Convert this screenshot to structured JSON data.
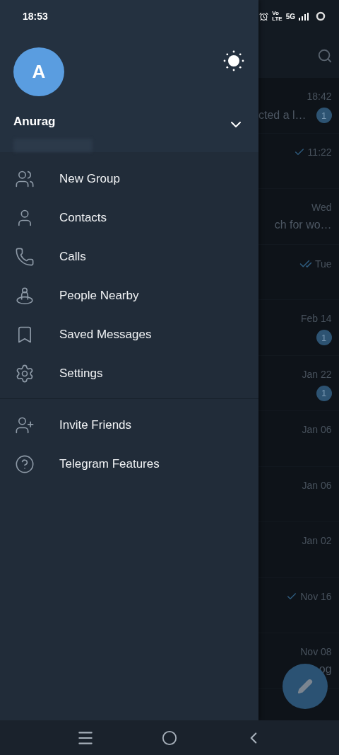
{
  "status_bar": {
    "time": "18:53",
    "volte_top": "Vo",
    "volte_bottom": "LTE",
    "network": "5G"
  },
  "drawer": {
    "avatar_initial": "A",
    "name": "Anurag",
    "accounts_expanded": false,
    "menu_sections": [
      [
        {
          "label": "New Group"
        },
        {
          "label": "Contacts"
        },
        {
          "label": "Calls"
        },
        {
          "label": "People Nearby"
        },
        {
          "label": "Saved Messages"
        },
        {
          "label": "Settings"
        }
      ],
      [
        {
          "label": "Invite Friends"
        },
        {
          "label": "Telegram Features"
        }
      ]
    ]
  },
  "chat_list": {
    "rows": [
      {
        "time": "18:42",
        "kind": "plain",
        "preview": "cted a l…",
        "unread": "1"
      },
      {
        "time": "11:22",
        "kind": "sent"
      },
      {
        "time": "Wed",
        "kind": "plain",
        "preview": "ch for wo…"
      },
      {
        "time": "Tue",
        "kind": "read"
      },
      {
        "time": "Feb 14",
        "kind": "plain",
        "unread": "1"
      },
      {
        "time": "Jan 22",
        "kind": "plain",
        "unread": "1"
      },
      {
        "time": "Jan 06",
        "kind": "plain"
      },
      {
        "time": "Jan 06",
        "kind": "plain"
      },
      {
        "time": "Jan 02",
        "kind": "plain"
      },
      {
        "time": "Nov 16",
        "kind": "sent"
      },
      {
        "time": "Nov 08",
        "kind": "plain",
        "preview": "og"
      }
    ]
  }
}
